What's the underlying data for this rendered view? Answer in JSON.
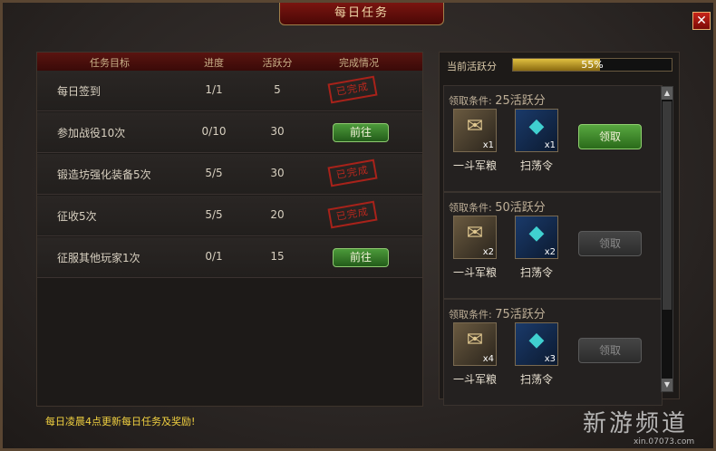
{
  "window": {
    "title": "每日任务",
    "close_label": "✕"
  },
  "task_table": {
    "headers": [
      "任务目标",
      "进度",
      "活跃分",
      "完成情况"
    ],
    "rows": [
      {
        "name": "每日签到",
        "progress": "1/1",
        "points": "5",
        "status": "done",
        "status_label": "已完成"
      },
      {
        "name": "参加战役10次",
        "progress": "0/10",
        "points": "30",
        "status": "go",
        "status_label": "前往"
      },
      {
        "name": "锻造坊强化装备5次",
        "progress": "5/5",
        "points": "30",
        "status": "done",
        "status_label": "已完成"
      },
      {
        "name": "征收5次",
        "progress": "5/5",
        "points": "20",
        "status": "done",
        "status_label": "已完成"
      },
      {
        "name": "征服其他玩家1次",
        "progress": "0/1",
        "points": "15",
        "status": "go",
        "status_label": "前往"
      }
    ]
  },
  "notice": "每日凌晨4点更新每日任务及奖励!",
  "activity": {
    "label": "当前活跃分",
    "percent_text": "55%",
    "percent": 55
  },
  "rewards": [
    {
      "condition_prefix": "领取条件:",
      "condition_value": "25活跃分",
      "items": [
        {
          "name": "一斗军粮",
          "qty": "x1",
          "icon": "grain-scroll-icon"
        },
        {
          "name": "扫荡令",
          "qty": "x1",
          "icon": "sweep-token-icon"
        }
      ],
      "claim_label": "领取",
      "claim_enabled": true
    },
    {
      "condition_prefix": "领取条件:",
      "condition_value": "50活跃分",
      "items": [
        {
          "name": "一斗军粮",
          "qty": "x2",
          "icon": "grain-scroll-icon"
        },
        {
          "name": "扫荡令",
          "qty": "x2",
          "icon": "sweep-token-icon"
        }
      ],
      "claim_label": "领取",
      "claim_enabled": false
    },
    {
      "condition_prefix": "领取条件:",
      "condition_value": "75活跃分",
      "items": [
        {
          "name": "一斗军粮",
          "qty": "x4",
          "icon": "grain-scroll-icon"
        },
        {
          "name": "扫荡令",
          "qty": "x3",
          "icon": "sweep-token-icon"
        }
      ],
      "claim_label": "领取",
      "claim_enabled": false
    }
  ],
  "scrollbar": {
    "up": "▲",
    "down": "▼"
  },
  "watermark": {
    "main": "新游频道",
    "sub": "xin.07073.com"
  }
}
